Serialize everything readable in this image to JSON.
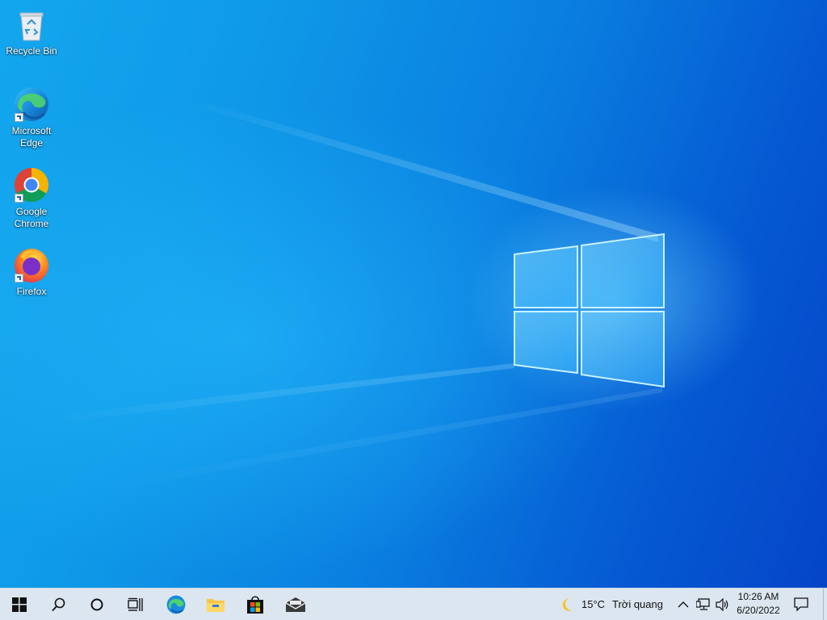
{
  "desktop": {
    "icons": [
      {
        "label_line1": "Recycle Bin",
        "label_line2": "",
        "icon": "recycle-bin-icon"
      },
      {
        "label_line1": "Microsoft",
        "label_line2": "Edge",
        "icon": "edge-icon"
      },
      {
        "label_line1": "Google",
        "label_line2": "Chrome",
        "icon": "chrome-icon"
      },
      {
        "label_line1": "Firefox",
        "label_line2": "",
        "icon": "firefox-icon"
      }
    ]
  },
  "taskbar": {
    "pinned": [
      "start-icon",
      "search-icon",
      "cortana-icon",
      "task-view-icon",
      "edge-icon",
      "file-explorer-icon",
      "store-icon",
      "mail-icon"
    ],
    "weather": {
      "temperature": "15°C",
      "condition": "Trời quang",
      "icon": "moon-icon"
    },
    "tray_icons": [
      "chevron-up-icon",
      "network-icon",
      "volume-icon"
    ],
    "clock": {
      "time": "10:26 AM",
      "date": "6/20/2022"
    },
    "notifications_icon": "notification-icon"
  },
  "colors": {
    "taskbar_bg": "#dce6f0",
    "wallpaper_accent": "#0a7fe0"
  }
}
